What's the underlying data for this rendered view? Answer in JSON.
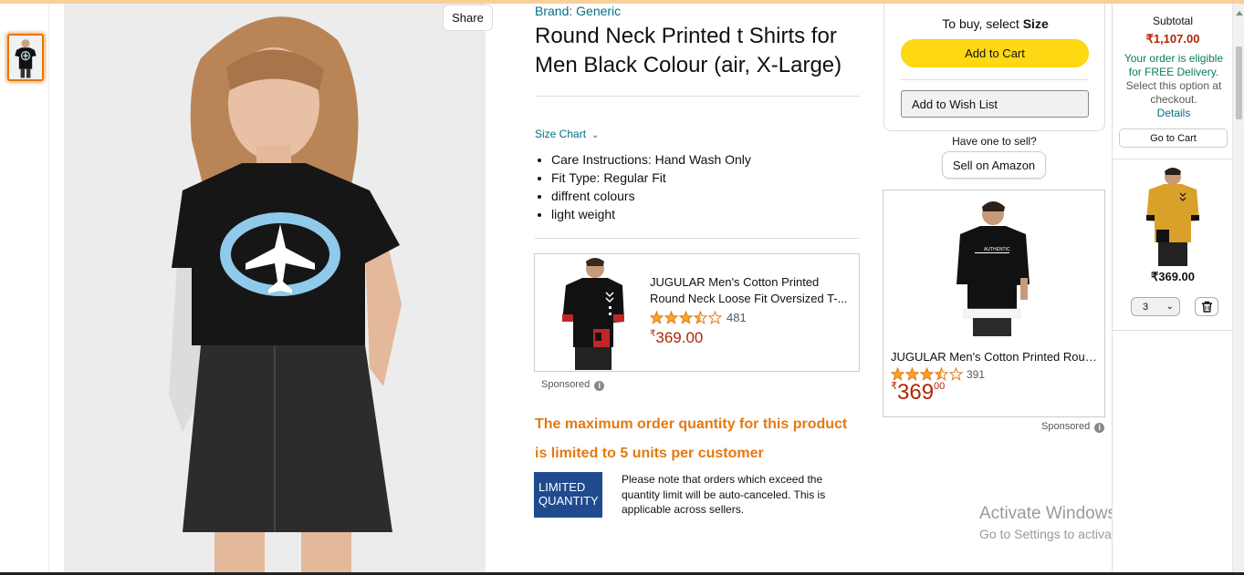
{
  "share_label": "Share",
  "product": {
    "brand": "Brand: Generic",
    "title": "Round Neck Printed t Shirts for Men Black Colour (air, X-Large)",
    "size_chart": "Size Chart",
    "bullets": [
      "Care Instructions: Hand Wash Only",
      "Fit Type: Regular Fit",
      "diffrent colours",
      "light weight"
    ]
  },
  "ad_left": {
    "title_line1": "JUGULAR Men's Cotton Printed",
    "title_line2": "Round Neck Loose Fit Oversized T-...",
    "rating": 3.5,
    "reviews": "481",
    "currency": "₹",
    "price": "369.00",
    "sponsored": "Sponsored"
  },
  "max_qty": {
    "message": "The maximum order quantity for this product is limited to 5 units per customer",
    "badge_line1": "LIMITED",
    "badge_line2": "QUANTITY",
    "note": "Please note that orders which exceed the quantity limit will be auto-canceled. This is applicable across sellers."
  },
  "buybox": {
    "prompt": "To buy, select",
    "prompt_bold": "Size",
    "add_to_cart": "Add to Cart",
    "wishlist": "Add to Wish List",
    "have_one": "Have one to sell?",
    "sell": "Sell on Amazon"
  },
  "ad_right": {
    "title": "JUGULAR Men's Cotton Printed Round Neck Loose Fit",
    "rating": 3.5,
    "reviews": "391",
    "currency": "₹",
    "price_whole": "369",
    "price_fraction": "00",
    "sponsored": "Sponsored"
  },
  "watermark": {
    "line1": "Activate Windows",
    "line2": "Go to Settings to activate Windows."
  },
  "cart": {
    "subtotal_label": "Subtotal",
    "subtotal": "₹1,107.00",
    "free_green": "Your order is eligible for FREE Delivery.",
    "free_rest": "Select this option at checkout.",
    "details": "Details",
    "go_to_cart": "Go to Cart",
    "item_price": "₹369.00",
    "qty": "3"
  },
  "colors": {
    "accent_yellow": "#ffd814",
    "price_red": "#b12704",
    "link_teal": "#007185",
    "warning_orange": "#e47911",
    "badge_blue": "#1f4b8e"
  }
}
